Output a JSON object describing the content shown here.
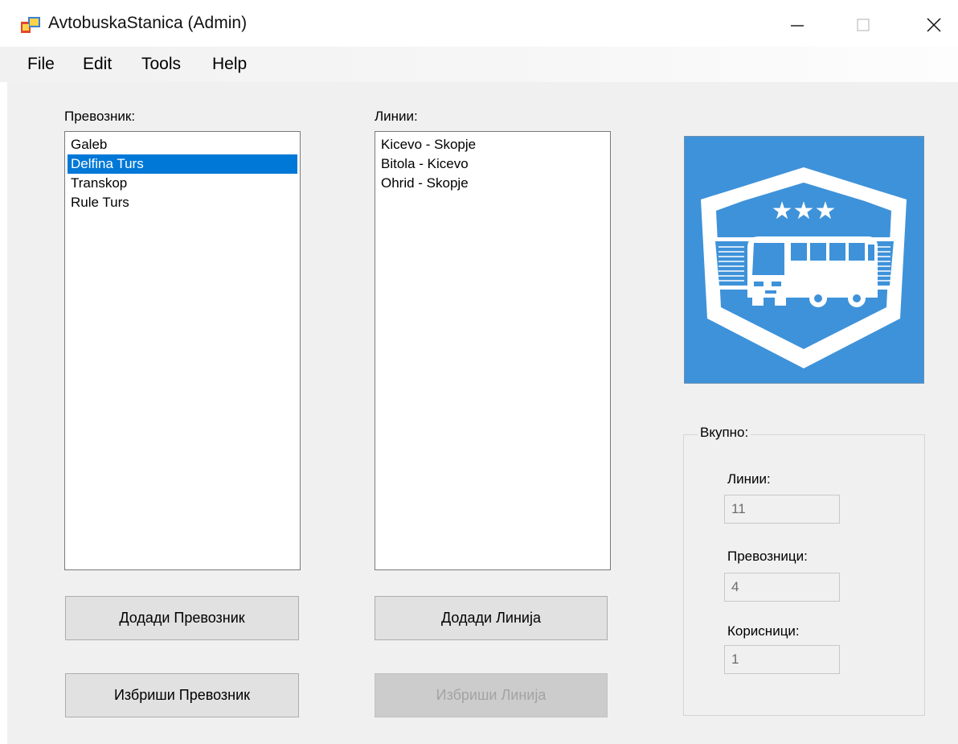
{
  "window": {
    "title": "AvtobuskaStanica (Admin)",
    "controls": {
      "minimize": "—",
      "maximize": "☐",
      "close": "✕"
    }
  },
  "menu": [
    "File",
    "Edit",
    "Tools",
    "Help"
  ],
  "carriers": {
    "label": "Превозник:",
    "items": [
      "Galeb",
      "Delfina Turs",
      "Transkop",
      "Rule Turs"
    ],
    "selected": "Delfina Turs"
  },
  "lines": {
    "label": "Линии:",
    "items": [
      "Kicevo - Skopje",
      "Bitola - Kicevo",
      "Ohrid - Skopje"
    ]
  },
  "buttons": {
    "add_carrier": "Додади Превозник",
    "delete_carrier": "Избриши Превозник",
    "add_line": "Додади Линија",
    "delete_line": "Избриши Линија"
  },
  "logo": {
    "icon": "bus-shield-logo",
    "stars": "★★★"
  },
  "totals": {
    "title": "Вкупно:",
    "lines_label": "Линии:",
    "lines_value": "11",
    "carriers_label": "Превозници:",
    "carriers_value": "4",
    "users_label": "Корисници:",
    "users_value": "1"
  },
  "colors": {
    "selection": "#0078d7",
    "logo_background": "#3e92d9",
    "client_background": "#f0f0f0"
  }
}
